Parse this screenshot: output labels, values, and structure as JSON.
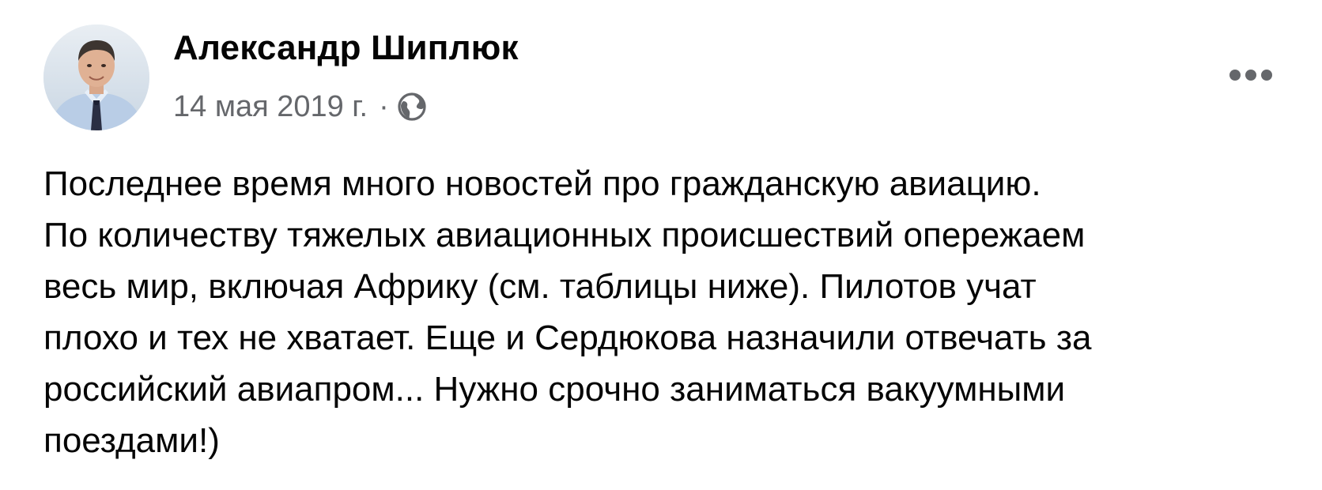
{
  "post": {
    "author": {
      "name": "Александр Шиплюк",
      "avatar_icon": "profile-photo"
    },
    "meta": {
      "date": "14 мая 2019 г.",
      "separator": "·",
      "audience_icon": "globe-icon"
    },
    "more_icon": "more-options-icon",
    "text": "Последнее время много новостей про гражданскую авиацию.\nПо количеству тяжелых авиационных происшествий опережаем\nвесь мир, включая Африку (см. таблицы ниже). Пилотов учат\nплохо и тех не хватает. Еще и Сердюкова назначили отвечать за\nроссийский авиапром... Нужно срочно заниматься вакуумными\nпоездами!)"
  },
  "colors": {
    "text_primary": "#050505",
    "text_secondary": "#65676b",
    "background": "#ffffff"
  }
}
